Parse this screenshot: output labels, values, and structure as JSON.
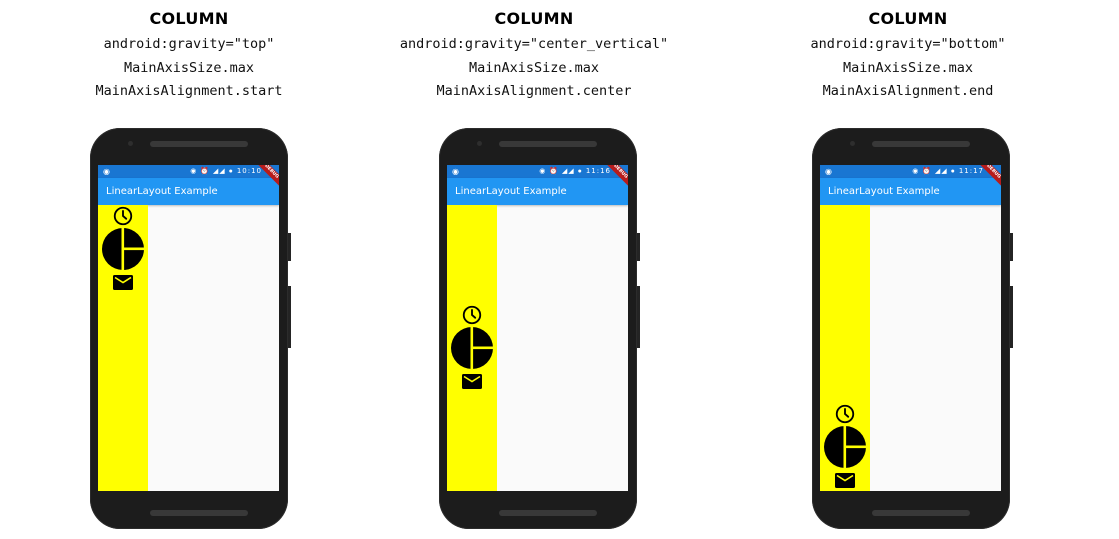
{
  "panels": [
    {
      "heading": "COLUMN",
      "gravity": "android:gravity=\"top\"",
      "size": "MainAxisSize.max",
      "alignment": "MainAxisAlignment.start",
      "status_time": "10:10",
      "app_title": "LinearLayout Example",
      "banner": "DEBUG"
    },
    {
      "heading": "COLUMN",
      "gravity": "android:gravity=\"center_vertical\"",
      "size": "MainAxisSize.max",
      "alignment": "MainAxisAlignment.center",
      "status_time": "11:16",
      "app_title": "LinearLayout Example",
      "banner": "DEBUG"
    },
    {
      "heading": "COLUMN",
      "gravity": "android:gravity=\"bottom\"",
      "size": "MainAxisSize.max",
      "alignment": "MainAxisAlignment.end",
      "status_time": "11:17",
      "app_title": "LinearLayout Example",
      "banner": "DEBUG"
    }
  ],
  "icons": [
    "clock-icon",
    "pie-chart-icon",
    "mail-icon"
  ],
  "colors": {
    "status_bar": "#1976d2",
    "app_bar": "#2196f3",
    "column_bg": "#ffff00",
    "screen_bg": "#fafafa",
    "phone_body": "#1c1c1c",
    "debug_banner": "#b71c1c"
  }
}
